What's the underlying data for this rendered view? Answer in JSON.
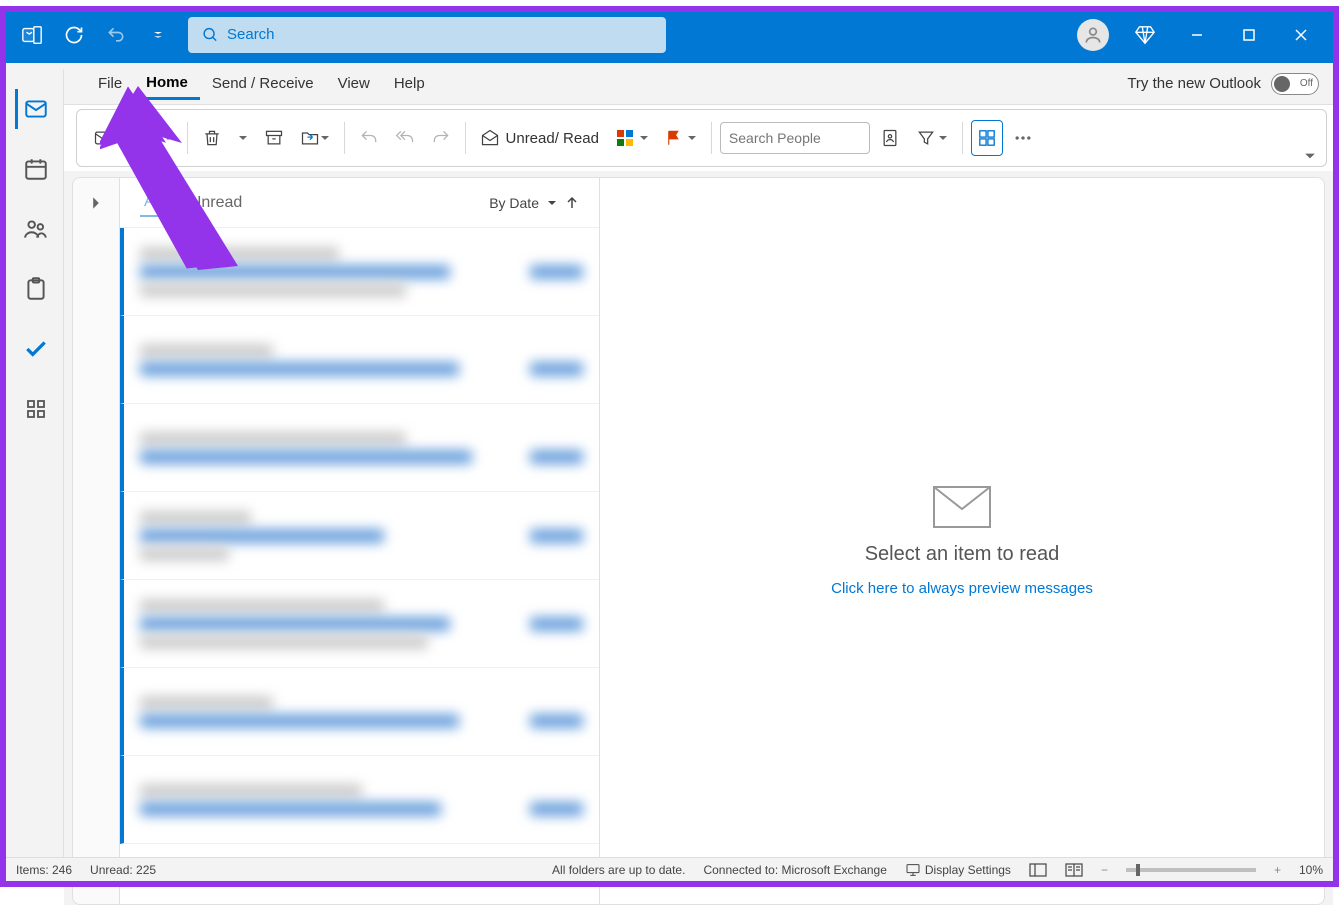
{
  "titlebar": {
    "search_placeholder": "Search"
  },
  "menu": {
    "items": [
      "File",
      "Home",
      "Send / Receive",
      "View",
      "Help"
    ],
    "active_index": 1,
    "try_new": "Try the new Outlook",
    "toggle_state": "Off"
  },
  "ribbon": {
    "new_email": "Email",
    "unread_read": "Unread/ Read",
    "search_people_placeholder": "Search People"
  },
  "msglist": {
    "tab_all": "All",
    "tab_unread": "Unread",
    "sort_label": "By Date"
  },
  "reading": {
    "title": "Select an item to read",
    "link": "Click here to always preview messages"
  },
  "statusbar": {
    "items": "Items: 246",
    "unread": "Unread: 225",
    "sync": "All folders are up to date.",
    "connected": "Connected to: Microsoft Exchange",
    "display": "Display Settings",
    "zoom": "10%"
  }
}
